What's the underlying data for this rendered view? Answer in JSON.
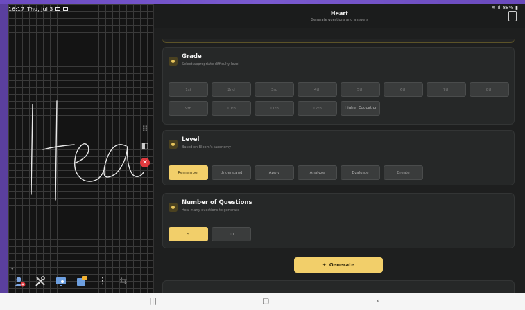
{
  "status": {
    "time": "16:17",
    "date": "Thu, Jul 3",
    "battery": "88%"
  },
  "app": {
    "title": "Heart",
    "subtitle": "Generate questions and answers"
  },
  "grade": {
    "title": "Grade",
    "description": "Select appropriate difficulty level",
    "options": [
      "1st",
      "2nd",
      "3rd",
      "4th",
      "5th",
      "6th",
      "7th",
      "8th",
      "9th",
      "10th",
      "11th",
      "12th",
      "Higher Education"
    ]
  },
  "level": {
    "title": "Level",
    "description": "Based on Bloom's taxonomy",
    "options": [
      "Remember",
      "Understand",
      "Apply",
      "Analyze",
      "Evaluate",
      "Create"
    ],
    "selected": "Remember"
  },
  "questions": {
    "title": "Number of Questions",
    "description": "How many questions to generate",
    "options": [
      "5",
      "10"
    ],
    "selected": "5"
  },
  "actions": {
    "generate_label": "Generate"
  },
  "canvas": {
    "handwriting": "Hea"
  },
  "colors": {
    "accent": "#f2cf6a",
    "card": "#262828",
    "background": "#1e1f1f",
    "close": "#e0393e"
  },
  "icons": {
    "drag": "grip-icon",
    "panel": "panel-layout-icon",
    "close": "close-icon"
  }
}
